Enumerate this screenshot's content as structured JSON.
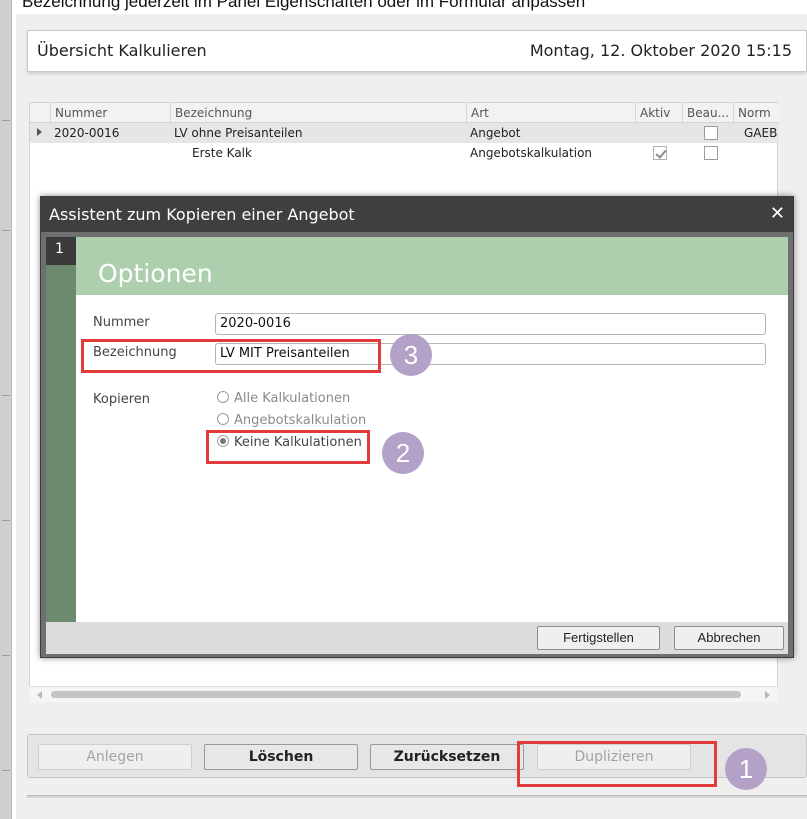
{
  "caption": "Bezeichnung jederzeit im Panel Eigenschaften oder im Formular anpassen",
  "header": {
    "title": "Übersicht Kalkulieren",
    "datetime": "Montag, 12. Oktober 2020 15:15"
  },
  "grid": {
    "columns": [
      "Nummer",
      "Bezeichnung",
      "Art",
      "Aktiv",
      "Beau...",
      "Norm"
    ],
    "rows": [
      {
        "nummer": "2020-0016",
        "bezeichnung": "LV ohne Preisanteilen",
        "art": "Angebot",
        "aktiv": false,
        "beau": false,
        "norm": "GAEB",
        "selected": true
      },
      {
        "nummer": "",
        "bezeichnung": "Erste Kalk",
        "art": "Angebotskalkulation",
        "aktiv": true,
        "beau": false,
        "norm": "",
        "selected": false
      }
    ]
  },
  "dialog": {
    "title": "Assistent zum Kopieren einer Angebot",
    "close_glyph": "✕",
    "step_number": "1",
    "section_title": "Optionen",
    "fields": {
      "nummer_label": "Nummer",
      "nummer_value": "2020-0016",
      "bezeichnung_label": "Bezeichnung",
      "bezeichnung_value": "LV MIT Preisanteilen",
      "kopieren_label": "Kopieren"
    },
    "radio_options": [
      {
        "label": "Alle Kalkulationen",
        "checked": false
      },
      {
        "label": "Angebotskalkulation",
        "checked": false
      },
      {
        "label": "Keine Kalkulationen",
        "checked": true
      }
    ],
    "buttons": {
      "finish": "Fertigstellen",
      "cancel": "Abbrechen"
    }
  },
  "toolbar": {
    "create": "Anlegen",
    "delete": "Löschen",
    "reset": "Zurücksetzen",
    "duplicate": "Duplizieren"
  },
  "annotations": {
    "badge1": "1",
    "badge2": "2",
    "badge3": "3"
  },
  "colors": {
    "accent_red": "#e03c3c",
    "badge_purple": "#b3a1c8",
    "dialog_title": "#3f3f3f",
    "options_band": "#adcfae"
  }
}
